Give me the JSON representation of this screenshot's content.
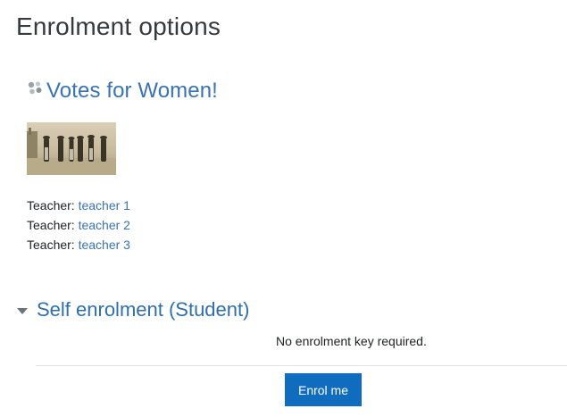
{
  "page": {
    "title": "Enrolment options"
  },
  "course": {
    "name": "Votes for Women!",
    "icon": "course-tiles-icon",
    "image_alt": "course-image"
  },
  "teachers": [
    {
      "label": "Teacher: ",
      "name": "teacher 1"
    },
    {
      "label": "Teacher: ",
      "name": "teacher 2"
    },
    {
      "label": "Teacher: ",
      "name": "teacher 3"
    }
  ],
  "enrolment": {
    "section_title": "Self enrolment (Student)",
    "key_note": "No enrolment key required.",
    "button_label": "Enrol me"
  },
  "colors": {
    "link": "#3973b5",
    "button": "#0f6cbf",
    "divider": "#dee2e6"
  }
}
